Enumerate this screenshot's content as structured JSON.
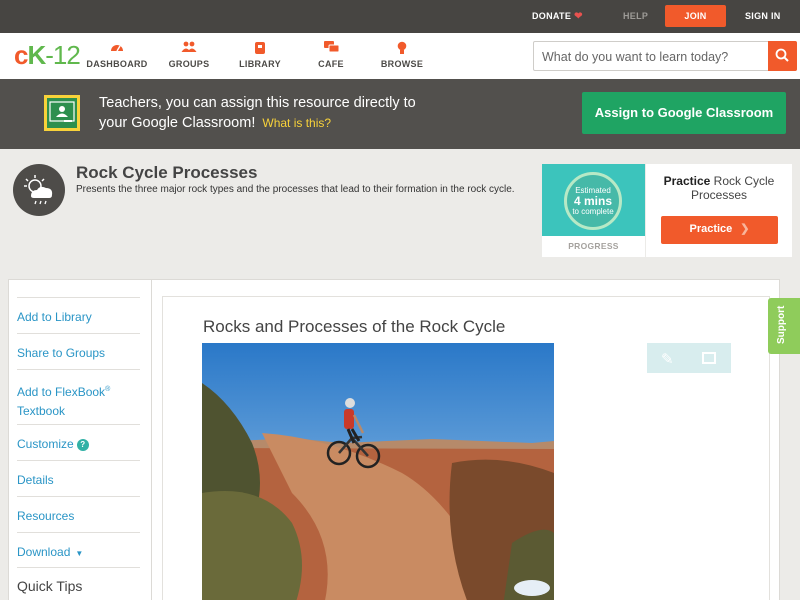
{
  "topbar": {
    "donate": "DONATE",
    "help": "HELP",
    "join": "JOIN",
    "signin": "SIGN IN"
  },
  "nav": {
    "logo": {
      "c": "c",
      "k": "K",
      "n": "-12"
    },
    "items": [
      {
        "label": "DASHBOARD",
        "icon": "gauge-icon"
      },
      {
        "label": "GROUPS",
        "icon": "people-icon"
      },
      {
        "label": "LIBRARY",
        "icon": "book-icon"
      },
      {
        "label": "CAFE",
        "icon": "chat-icon"
      },
      {
        "label": "BROWSE",
        "icon": "bulb-icon"
      }
    ],
    "search_placeholder": "What do you want to learn today?"
  },
  "classroom": {
    "line1": "Teachers, you can assign this resource directly to",
    "line2": "your Google Classroom!",
    "what": "What is this?",
    "button": "Assign to Google Classroom"
  },
  "resource": {
    "title": "Rock Cycle Processes",
    "description": "Presents the three major rock types and the processes that lead to their formation in the rock cycle."
  },
  "progress": {
    "estimated": "Estimated",
    "mins": "4 mins",
    "to_complete": "to complete",
    "label": "PROGRESS"
  },
  "practice": {
    "word": "Practice",
    "topic": "Rock Cycle Processes",
    "button": "Practice"
  },
  "sidebar": {
    "items": [
      {
        "label": "Add to Library"
      },
      {
        "label": "Share to Groups"
      },
      {
        "label": "Add to FlexBook",
        "sup": "®",
        "label2": "Textbook"
      },
      {
        "label": "Customize"
      },
      {
        "label": "Details"
      },
      {
        "label": "Resources"
      },
      {
        "label": "Download"
      }
    ],
    "quick_tips": "Quick Tips"
  },
  "content": {
    "title": "Rocks and Processes of the Rock Cycle"
  },
  "support": "Support",
  "colors": {
    "accent": "#f15a2b",
    "green": "#1fa463",
    "link": "#2a95c6",
    "teal": "#3cc4bc"
  }
}
